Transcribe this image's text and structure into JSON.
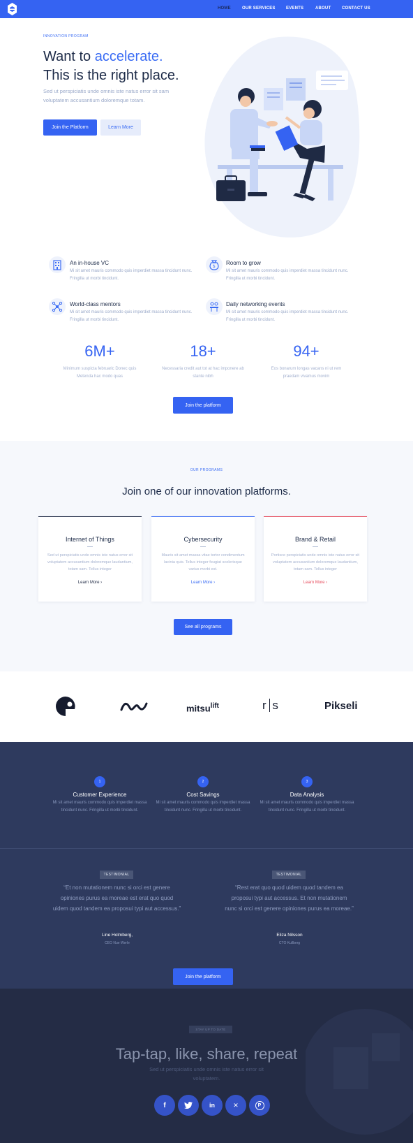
{
  "nav": {
    "items": [
      "HOME",
      "OUR SERVICES",
      "EVENTS",
      "ABOUT",
      "CONTACT US"
    ],
    "active": "HOME",
    "brand_color": "#3563f2"
  },
  "hero": {
    "eyebrow": "INNOVATION PROGRAM",
    "title_prefix": "Want to ",
    "title_accent": "accelerate.",
    "title_line2": "This is the right place.",
    "subtitle": "Sed ut perspiciatis unde omnis iste natus error sit sam voluptatem accusantium doloremque totam.",
    "primary_button": "Join the Platform",
    "secondary_button": "Learn More"
  },
  "features": [
    {
      "title": "An in-house VC",
      "desc": "Mi sit amet mauris commodo quis imperdiet massa tincidunt nunc. Fringilla ut morbi tincidunt.",
      "icon": "building-icon"
    },
    {
      "title": "Room to grow",
      "desc": "Mi sit amet mauris commodo quis imperdiet massa tincidunt nunc. Fringilla ut morbi tincidunt.",
      "icon": "money-bag-icon"
    },
    {
      "title": "World-class mentors",
      "desc": "Mi sit amet mauris commodo quis imperdiet massa tincidunt nunc. Fringilla ut morbi tincidunt.",
      "icon": "network-icon"
    },
    {
      "title": "Daily networking events",
      "desc": "Mi sit amet mauris commodo quis imperdiet massa tincidunt nunc. Fringilla ut morbi tincidunt.",
      "icon": "meeting-icon"
    }
  ],
  "stats": [
    {
      "value": "6M+",
      "desc": "Minimum suspicta februaric Donec quis Metenda hac modo quas"
    },
    {
      "value": "18+",
      "desc": "Necessaria credit aut tot at hac imponere ab stante nibh"
    },
    {
      "value": "94+",
      "desc": "Eos bonarum longas vacans ni ut rem praedam vivamus movim"
    }
  ],
  "stats_button": "Join the platform",
  "programs": {
    "eyebrow": "OUR PROGRAMS",
    "title": "Join one of our innovation platforms.",
    "cards": [
      {
        "title": "Internet of Things",
        "desc": "Sed ut perspiciatis unde omnis iste natus error sit voluptatem accusantium doloremque laudantium, totam sam. Tellus integer",
        "link": "Learn More",
        "accent": "#1f2a44"
      },
      {
        "title": "Cybersecurity",
        "desc": "Mauris sit amet massa vitae tortor condimentum lacinia quis. Tellus integer feugiat scelerisque varius morbi est.",
        "link": "Learn More",
        "accent": "#3a6cf4"
      },
      {
        "title": "Brand & Retail",
        "desc": "Portisce perspiciatis unde omnis iste natus error sit voluptatem accusantium doloremque laudantium, totam sam. Tellus integer",
        "link": "Learn More",
        "accent": "#e64a5b"
      }
    ],
    "button": "See all programs"
  },
  "clients": [
    "mitsu",
    "lift",
    "r",
    "s",
    "Pikseli"
  ],
  "highlights": [
    {
      "num": "1",
      "title": "Customer Experience",
      "desc": "Mi sit amet mauris commodo quis imperdiet massa tincidunt nunc. Fringilla ut morbi tincidunt."
    },
    {
      "num": "2",
      "title": "Cost Savings",
      "desc": "Mi sit amet mauris commodo quis imperdiet massa tincidunt nunc. Fringilla ut morbi tincidunt."
    },
    {
      "num": "3",
      "title": "Data Analysis",
      "desc": "Mi sit amet mauris commodo quis imperdiet massa tincidunt nunc. Fringilla ut morbi tincidunt."
    }
  ],
  "testimonials": [
    {
      "tag": "TESTIMONIAL",
      "quote": "“Et non mutationem nunc si orci est genere opiniones purus ea moreae est erat quo quod uidem quod tandem ea proposui typi aut accessus.”",
      "name": "Line Holmberg,",
      "role": "CEO Nue Werle"
    },
    {
      "tag": "TESTIMONIAL",
      "quote": "“Rest erat quo quod uidem quod tandem ea proposui typi aut accessus. Et non mutationem nunc si orci est genere opiniones purus ea moreae.”",
      "name": "Eliza Nilsson",
      "role": "CTO Kullberg"
    }
  ],
  "testimonial_button": "Join the platform",
  "newsletter": {
    "tag": "STAY UP TO DATE",
    "title": "Tap-tap, like, share, repeat",
    "subtitle": "Sed ut perspiciatis unde omnis iste natus error sit voluptatem.",
    "socials": [
      {
        "icon": "facebook-icon",
        "glyph": "f"
      },
      {
        "icon": "twitter-icon",
        "glyph": "🐦"
      },
      {
        "icon": "linkedin-icon",
        "glyph": "in"
      },
      {
        "icon": "xing-icon",
        "glyph": "✕"
      },
      {
        "icon": "pinterest-icon",
        "glyph": "P"
      }
    ]
  }
}
